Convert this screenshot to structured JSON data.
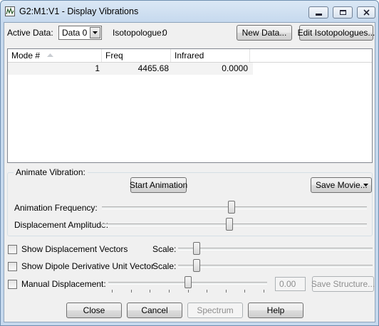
{
  "window": {
    "title": "G2:M1:V1 - Display Vibrations",
    "controls": {
      "minimize": "minimize-icon",
      "maximize": "maximize-icon",
      "close": "close-icon"
    }
  },
  "top": {
    "active_data_label": "Active Data:",
    "active_data_value": "Data 0",
    "isotopologue_label": "Isotopologue:",
    "isotopologue_value": "0",
    "new_data_button": "New Data...",
    "edit_isotopologues_button": "Edit Isotopologues..."
  },
  "table": {
    "columns": [
      "Mode #",
      "Freq",
      "Infrared"
    ],
    "sort_column": "Mode #",
    "sort_direction": "ascending",
    "rows": [
      {
        "mode": "1",
        "freq": "4465.68",
        "infrared": "0.0000"
      }
    ]
  },
  "animate": {
    "group_label": "Animate Vibration:",
    "start_button": "Start Animation",
    "save_movie_button": "Save Movie...",
    "frequency_label": "Animation Frequency:",
    "frequency_level": 0.49,
    "amplitude_label": "Displacement Amplitude:",
    "amplitude_level": 0.48
  },
  "options": {
    "show_displacement_vectors": {
      "label": "Show Displacement Vectors",
      "checked": false,
      "scale_label": "Scale:",
      "scale_level": 0.08
    },
    "show_dipole_vector": {
      "label": "Show Dipole Derivative Unit Vector",
      "checked": false,
      "scale_label": "Scale:",
      "scale_level": 0.08
    },
    "manual_displacement": {
      "label": "Manual Displacement:",
      "checked": false,
      "level": 0.5,
      "value": "0.00",
      "save_structure_button": "Save Structure..."
    }
  },
  "footer": {
    "close_button": "Close",
    "cancel_button": "Cancel",
    "spectrum_button": "Spectrum",
    "help_button": "Help"
  },
  "colors": {
    "title_gradient_top": "#dbe8f5",
    "client_bg": "#f0f0f0",
    "row_highlight": "#f3f3f3"
  }
}
